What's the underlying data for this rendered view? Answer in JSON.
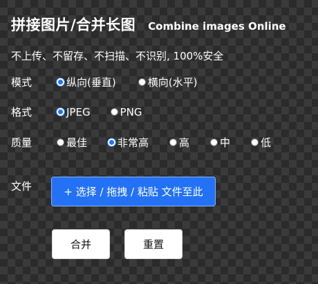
{
  "header": {
    "title": "拼接图片/合并长图",
    "subtitle": "Combine images Online"
  },
  "notice": "不上传、不留存、不扫描、不识别, 100%安全",
  "mode": {
    "label": "模式",
    "options": [
      {
        "label": "纵向(垂直)",
        "checked": true
      },
      {
        "label": "横向(水平)",
        "checked": false
      }
    ]
  },
  "format": {
    "label": "格式",
    "options": [
      {
        "label": "JPEG",
        "checked": true
      },
      {
        "label": "PNG",
        "checked": false
      }
    ]
  },
  "quality": {
    "label": "质量",
    "options": [
      {
        "label": "最佳",
        "checked": false
      },
      {
        "label": "非常高",
        "checked": true
      },
      {
        "label": "高",
        "checked": false
      },
      {
        "label": "中",
        "checked": false
      },
      {
        "label": "低",
        "checked": false
      }
    ]
  },
  "file": {
    "label": "文件",
    "upload_label": "+ 选择 / 拖拽 / 粘贴 文件至此"
  },
  "actions": {
    "merge_label": "合并",
    "reset_label": "重置"
  },
  "colors": {
    "accent": "#2372f6",
    "background_dark": "#2b2b2b",
    "background_light": "#3a3a3a"
  }
}
